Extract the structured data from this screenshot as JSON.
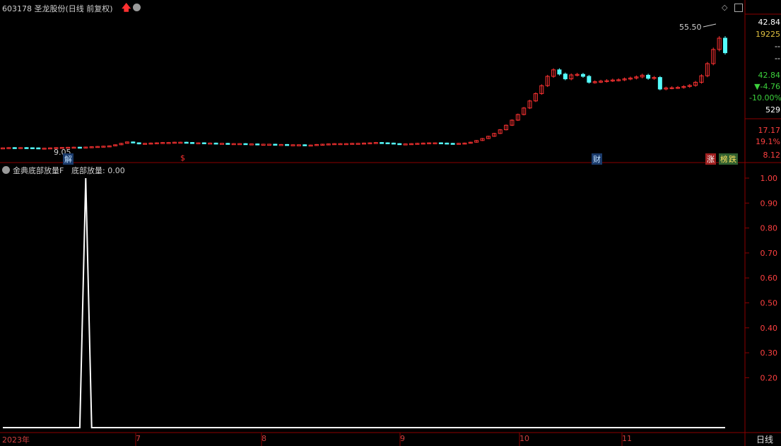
{
  "header": {
    "title": "603178 圣龙股份(日线 前复权)",
    "indicator_label": "金典底部放量F",
    "indicator_value": "底部放量: 0.00"
  },
  "right_panel": {
    "price_top": "42.84",
    "volume": "19225",
    "dash1": "--",
    "dash2": "--",
    "price_now": "42.84",
    "change": "▼-4.76",
    "change_pct": "-10.00%",
    "count": "529",
    "axis_1": "17.17",
    "axis_2": "19.1%",
    "axis_3": "8.12"
  },
  "tags": {
    "jie": "解",
    "s": "$",
    "cai": "财",
    "zhang": "涨",
    "bang": "榜",
    "die": "跌"
  },
  "price_annotations": {
    "high": "55.50",
    "low": "9.05"
  },
  "xaxis": {
    "labels": [
      "2023年",
      "7",
      "8",
      "9",
      "10",
      "11"
    ],
    "period": "日线"
  },
  "colors": {
    "up": "#ff3232",
    "down": "#54fcfc",
    "grid": "#8b0000",
    "green": "#3cd23c",
    "indicator": "#ffffff"
  },
  "chart_data": [
    {
      "type": "candlestick",
      "title": "603178 圣龙股份(日线 前复权)",
      "x_range": [
        "2023年",
        "11"
      ],
      "y_axis_labels": [
        "17.17",
        "19.1%",
        "8.12"
      ],
      "y_range": [
        8.12,
        55.5
      ],
      "annotations": [
        "55.50",
        "9.05"
      ],
      "close": [
        9.2,
        9.3,
        9.2,
        9.3,
        9.25,
        9.2,
        9.05,
        9.1,
        9.2,
        9.3,
        9.35,
        9.4,
        9.45,
        9.4,
        9.5,
        9.6,
        9.7,
        9.8,
        9.9,
        10.3,
        10.8,
        11.3,
        11.0,
        10.6,
        10.8,
        10.9,
        11.0,
        11.1,
        11.1,
        11.2,
        11.2,
        11.1,
        11.0,
        11.0,
        10.9,
        10.9,
        10.8,
        10.8,
        10.7,
        10.7,
        10.7,
        10.6,
        10.6,
        10.5,
        10.5,
        10.5,
        10.4,
        10.4,
        10.3,
        10.3,
        10.3,
        10.2,
        10.2,
        10.4,
        10.5,
        10.6,
        10.7,
        10.7,
        10.7,
        10.8,
        10.8,
        10.9,
        11.0,
        11.1,
        11.0,
        10.9,
        10.7,
        10.6,
        10.6,
        10.7,
        10.8,
        10.9,
        11.0,
        11.0,
        10.9,
        10.8,
        10.7,
        10.8,
        10.9,
        11.2,
        11.8,
        12.5,
        13.3,
        14.3,
        15.6,
        17.2,
        19.0,
        21.0,
        23.3,
        25.8,
        28.4,
        31.2,
        34.5,
        36.8,
        35.3,
        33.6,
        35.0,
        35.2,
        34.5,
        32.4,
        32.6,
        32.8,
        33.0,
        33.2,
        33.3,
        33.6,
        33.9,
        34.3,
        34.9,
        33.8,
        34.1,
        30.0,
        30.4,
        30.5,
        30.6,
        30.9,
        31.3,
        32.4,
        34.7,
        39.0,
        44.0,
        48.0,
        42.84
      ],
      "volume_note": "19225"
    },
    {
      "type": "line",
      "title": "金典底部放量F",
      "series": [
        {
          "name": "底部放量",
          "values": [
            0,
            0,
            0,
            0,
            0,
            0,
            0,
            0,
            0,
            0,
            0,
            0,
            0,
            0,
            1,
            0,
            0,
            0,
            0,
            0,
            0,
            0,
            0,
            0,
            0,
            0,
            0,
            0,
            0,
            0,
            0,
            0,
            0,
            0,
            0,
            0,
            0,
            0,
            0,
            0,
            0,
            0,
            0,
            0,
            0,
            0,
            0,
            0,
            0,
            0,
            0,
            0,
            0,
            0,
            0,
            0,
            0,
            0,
            0,
            0,
            0,
            0,
            0,
            0,
            0,
            0,
            0,
            0,
            0,
            0,
            0,
            0,
            0,
            0,
            0,
            0,
            0,
            0,
            0,
            0,
            0,
            0,
            0,
            0,
            0,
            0,
            0,
            0,
            0,
            0,
            0,
            0,
            0,
            0,
            0,
            0,
            0,
            0,
            0,
            0,
            0,
            0,
            0,
            0,
            0,
            0,
            0,
            0,
            0,
            0,
            0,
            0,
            0,
            0,
            0,
            0,
            0,
            0,
            0,
            0,
            0,
            0,
            0
          ]
        }
      ],
      "y_ticks": [
        "1.00",
        "0.90",
        "0.80",
        "0.70",
        "0.60",
        "0.50",
        "0.40",
        "0.30",
        "0.20"
      ],
      "ylim": [
        0,
        1.0
      ],
      "current_value": "0.00"
    }
  ]
}
